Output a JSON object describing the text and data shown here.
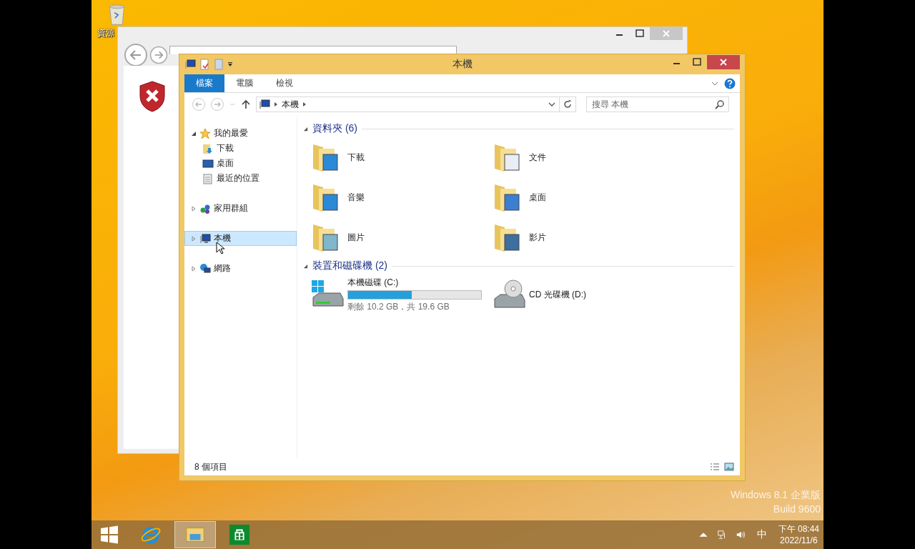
{
  "desktop": {
    "icons": [
      {
        "label": "資源"
      }
    ],
    "watermark_lines": [
      "Windows 8.1 企業版",
      "Build 9600"
    ]
  },
  "explorer": {
    "title": "本機",
    "ribbon_tabs": [
      {
        "label": "檔案",
        "selected": true
      },
      {
        "label": "電腦",
        "selected": false
      },
      {
        "label": "檢視",
        "selected": false
      }
    ],
    "address": {
      "path": [
        "本機"
      ]
    },
    "search": {
      "placeholder": "搜尋 本機"
    },
    "nav": [
      {
        "label": "我的最愛",
        "kind": "favorites",
        "expanded": true,
        "selected": false,
        "children": [
          {
            "label": "下載",
            "kind": "downloads",
            "selected": false
          },
          {
            "label": "桌面",
            "kind": "desktop",
            "selected": false
          },
          {
            "label": "最近的位置",
            "kind": "recent",
            "selected": false
          }
        ]
      },
      {
        "label": "家用群組",
        "kind": "homegroup",
        "expanded": false,
        "selected": false
      },
      {
        "label": "本機",
        "kind": "pc",
        "expanded": false,
        "selected": true
      },
      {
        "label": "網路",
        "kind": "network",
        "expanded": false,
        "selected": false
      }
    ],
    "groups": [
      {
        "title": "資料夾 (6)",
        "expanded": true,
        "items": [
          {
            "label": "下載",
            "kind": "downloads"
          },
          {
            "label": "文件",
            "kind": "documents"
          },
          {
            "label": "音樂",
            "kind": "music"
          },
          {
            "label": "桌面",
            "kind": "desktop"
          },
          {
            "label": "圖片",
            "kind": "pictures"
          },
          {
            "label": "影片",
            "kind": "videos"
          }
        ]
      },
      {
        "title": "裝置和磁碟機 (2)",
        "expanded": true,
        "items": [
          {
            "label": "本機磁碟 (C:)",
            "kind": "disk",
            "level": 0.48,
            "detail": "剩餘 10.2 GB，共 19.6 GB"
          },
          {
            "label": "CD 光碟機 (D:)",
            "kind": "cd"
          }
        ]
      }
    ],
    "status_bar": {
      "item_count": "8 個項目"
    }
  },
  "taskbar": {
    "apps": [
      {
        "kind": "ie",
        "selected": false
      },
      {
        "kind": "explorer",
        "selected": true
      },
      {
        "kind": "store",
        "selected": false
      }
    ],
    "tray": {
      "ime": "中",
      "time": "下午 08:44",
      "date": "2022/11/6"
    }
  }
}
